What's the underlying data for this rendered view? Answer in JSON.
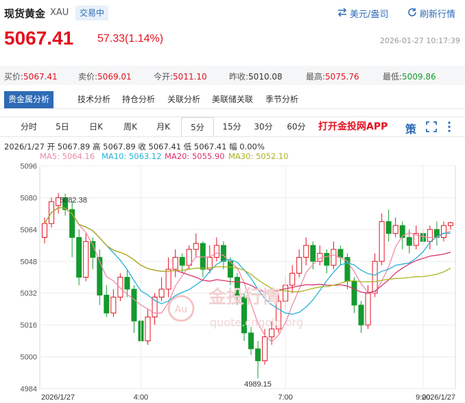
{
  "header": {
    "title": "现货黄金",
    "symbol": "XAU",
    "status": "交易中",
    "currency_switch": "美元/盎司",
    "refresh": "刷新行情"
  },
  "quote": {
    "price": "5067.41",
    "change": "57.33(1.14%)",
    "time": "2026-01-27 10:17:39"
  },
  "stats": {
    "buy_label": "买价:",
    "buy": "5067.41",
    "sell_label": "卖价:",
    "sell": "5069.01",
    "open_label": "今开:",
    "open": "5011.10",
    "prev_label": "昨收:",
    "prev": "5010.08",
    "high_label": "最高:",
    "high": "5075.76",
    "low_label": "最低:",
    "low": "5009.86"
  },
  "analysis_tabs": [
    "贵金属分析",
    "技术分析",
    "持仓分析",
    "关联分析",
    "美联储关联",
    "季节分析"
  ],
  "period_tabs": [
    "分时",
    "5日",
    "日K",
    "周K",
    "月K",
    "5分",
    "15分",
    "30分",
    "60分"
  ],
  "active_period": "5分",
  "open_app": "打开金投网APP",
  "strategy_icon": "策",
  "ohlc_line": "2026/1/27  开 5067.89  高 5067.89  收 5067.41  低 5067.41  幅 0.00%",
  "ma_labels": {
    "ma5": "MA5: 5064.16",
    "ma10": "MA10: 5063.12",
    "ma20": "MA20: 5055.90",
    "ma30": "MA30: 5052.10"
  },
  "colors": {
    "up": "#e4101f",
    "down": "#149a2e",
    "accent": "#2d6bb5",
    "ma5": "#f08aa6",
    "ma10": "#23b2d6",
    "ma20": "#d8336b",
    "ma30": "#a9b321"
  },
  "watermark": "金投行情",
  "watermark_domain": "quote.cngold.org",
  "chart_data": {
    "type": "candlestick",
    "y_ticks": [
      5096,
      5080,
      5064,
      5048,
      5032,
      5016,
      5000,
      4984
    ],
    "ylim": [
      4984,
      5096
    ],
    "x_ticks": [
      "2026/1/27",
      "4:00",
      "7:00",
      "9:00",
      "2026/1/27"
    ],
    "max_label": "5082.38",
    "min_label": "4989.15",
    "candles": [
      [
        5060,
        5067,
        5057,
        5070
      ],
      [
        5067,
        5078,
        5065,
        5080
      ],
      [
        5076,
        5080,
        5072,
        5082.38
      ],
      [
        5080,
        5074,
        5071,
        5082
      ],
      [
        5074,
        5060,
        5050,
        5078
      ],
      [
        5060,
        5040,
        5036,
        5064
      ],
      [
        5040,
        5058,
        5038,
        5062
      ],
      [
        5058,
        5050,
        5044,
        5060
      ],
      [
        5050,
        5031,
        5026,
        5054
      ],
      [
        5031,
        5022,
        5020,
        5036
      ],
      [
        5022,
        5030,
        5020,
        5034
      ],
      [
        5030,
        5040,
        5028,
        5042
      ],
      [
        5040,
        5034,
        5030,
        5044
      ],
      [
        5034,
        5018,
        5012,
        5036
      ],
      [
        5018,
        5008,
        5006,
        5022
      ],
      [
        5008,
        5020,
        5006,
        5024
      ],
      [
        5020,
        5030,
        5016,
        5032
      ],
      [
        5030,
        5034,
        5028,
        5040
      ],
      [
        5034,
        5044,
        5030,
        5050
      ],
      [
        5044,
        5050,
        5040,
        5054
      ],
      [
        5050,
        5046,
        5042,
        5052
      ],
      [
        5046,
        5054,
        5044,
        5056
      ],
      [
        5054,
        5057,
        5050,
        5062
      ],
      [
        5057,
        5044,
        5040,
        5058
      ],
      [
        5044,
        5050,
        5042,
        5056
      ],
      [
        5050,
        5056,
        5048,
        5060
      ],
      [
        5056,
        5048,
        5044,
        5058
      ],
      [
        5048,
        5040,
        5036,
        5050
      ],
      [
        5040,
        5030,
        5026,
        5042
      ],
      [
        5030,
        5012,
        5008,
        5032
      ],
      [
        5012,
        5004,
        5001,
        5015
      ],
      [
        5004,
        4998,
        4989.15,
        5008
      ],
      [
        4998,
        5010,
        4996,
        5014
      ],
      [
        5010,
        5014,
        5006,
        5018
      ],
      [
        5014,
        5028,
        5012,
        5032
      ],
      [
        5028,
        5036,
        5024,
        5040
      ],
      [
        5036,
        5042,
        5032,
        5046
      ],
      [
        5042,
        5050,
        5040,
        5054
      ],
      [
        5050,
        5056,
        5046,
        5060
      ],
      [
        5056,
        5048,
        5044,
        5058
      ],
      [
        5048,
        5052,
        5046,
        5056
      ],
      [
        5052,
        5046,
        5042,
        5054
      ],
      [
        5046,
        5054,
        5044,
        5058
      ],
      [
        5054,
        5050,
        5046,
        5056
      ],
      [
        5050,
        5038,
        5034,
        5052
      ],
      [
        5038,
        5026,
        5022,
        5040
      ],
      [
        5026,
        5016,
        5012,
        5028
      ],
      [
        5016,
        5032,
        5014,
        5036
      ],
      [
        5032,
        5048,
        5030,
        5052
      ],
      [
        5048,
        5068,
        5046,
        5072
      ],
      [
        5068,
        5062,
        5058,
        5074
      ],
      [
        5062,
        5066,
        5060,
        5070
      ],
      [
        5066,
        5060,
        5054,
        5068
      ],
      [
        5060,
        5056,
        5052,
        5064
      ],
      [
        5056,
        5062,
        5054,
        5066
      ],
      [
        5062,
        5058,
        5056,
        5064
      ],
      [
        5058,
        5064,
        5054,
        5066
      ],
      [
        5064,
        5060,
        5056,
        5068
      ],
      [
        5060,
        5066,
        5058,
        5068
      ],
      [
        5066,
        5067.41,
        5064,
        5067.89
      ]
    ]
  }
}
